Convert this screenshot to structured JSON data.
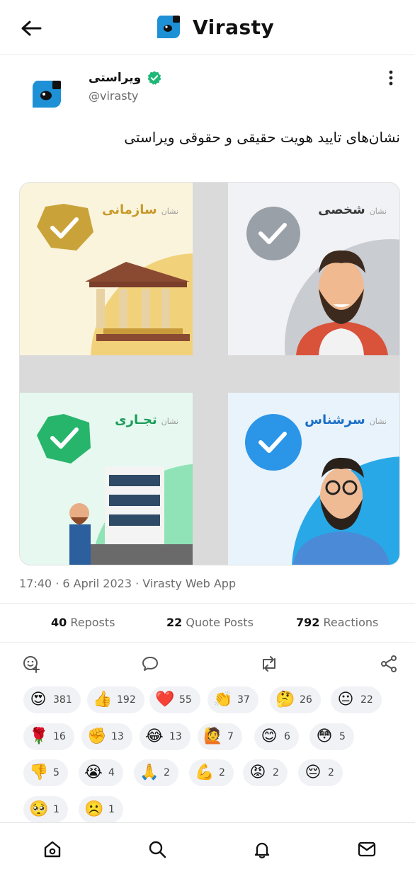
{
  "header": {
    "brand": "Virasty",
    "back_icon": "arrow-left-icon",
    "logo_icon": "virasty-logo-icon"
  },
  "post": {
    "author_name": "ویراستی",
    "handle": "@virasty",
    "text": "نشان‌های تایید هویت حقیقی و حقوقی ویراستی",
    "more_icon": "more-vertical-icon"
  },
  "media": {
    "tiles": [
      {
        "prefix": "نشان",
        "title": "سازمانی",
        "color": "#c79a2a"
      },
      {
        "prefix": "نشان",
        "title": "شخصی",
        "color": "#3a3a3a"
      },
      {
        "prefix": "نشان",
        "title": "تجـاری",
        "color": "#1a9c5a"
      },
      {
        "prefix": "نشان",
        "title": "سرشناس",
        "color": "#1b6fc7"
      }
    ]
  },
  "meta": {
    "time": "17:40",
    "date": "6 April 2023",
    "source": "Virasty Web App"
  },
  "stats": {
    "reposts_count": "40",
    "reposts_label": "Reposts",
    "quotes_count": "22",
    "quotes_label": "Quote Posts",
    "reactions_count": "792",
    "reactions_label": "Reactions"
  },
  "actions": [
    "add-reaction-icon",
    "comment-icon",
    "repost-icon",
    "share-icon"
  ],
  "reactions": [
    {
      "emoji": "😍",
      "count": "381"
    },
    {
      "emoji": "👍",
      "count": "192"
    },
    {
      "emoji": "❤️",
      "count": "55"
    },
    {
      "emoji": "👏",
      "count": "37"
    },
    {
      "emoji": "🤔",
      "count": "26"
    },
    {
      "emoji": "😐",
      "count": "22"
    },
    {
      "emoji": "🌹",
      "count": "16"
    },
    {
      "emoji": "✊",
      "count": "13"
    },
    {
      "emoji": "😂",
      "count": "13"
    },
    {
      "emoji": "🙋",
      "count": "7"
    },
    {
      "emoji": "😊",
      "count": "6"
    },
    {
      "emoji": "😳",
      "count": "5"
    },
    {
      "emoji": "👎",
      "count": "5"
    },
    {
      "emoji": "😭",
      "count": "4"
    },
    {
      "emoji": "🙏",
      "count": "2"
    },
    {
      "emoji": "💪",
      "count": "2"
    },
    {
      "emoji": "😡",
      "count": "2"
    },
    {
      "emoji": "😔",
      "count": "2"
    },
    {
      "emoji": "🥺",
      "count": "1"
    },
    {
      "emoji": "☹️",
      "count": "1"
    }
  ],
  "bottom_nav": [
    "home-icon",
    "search-icon",
    "notifications-icon",
    "messages-icon"
  ],
  "colors": {
    "brand_blue": "#1e90d6",
    "verified_green": "#1fb877",
    "muted": "#6b6b6b"
  }
}
